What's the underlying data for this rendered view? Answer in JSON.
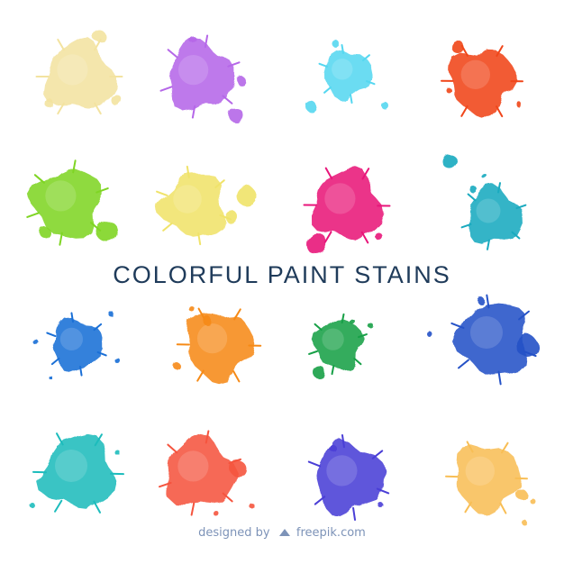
{
  "title": "COLORFUL PAINT STAINS",
  "credit": {
    "prefix": "designed by",
    "brand": "freepik.com"
  },
  "stains": [
    {
      "name": "cream",
      "color": "#f3e3a0"
    },
    {
      "name": "purple",
      "color": "#b567e8"
    },
    {
      "name": "cyan",
      "color": "#55d7f0"
    },
    {
      "name": "red-orange",
      "color": "#f0461a"
    },
    {
      "name": "lime-green",
      "color": "#7fd524"
    },
    {
      "name": "yellow",
      "color": "#f0e36a"
    },
    {
      "name": "magenta",
      "color": "#e8157a"
    },
    {
      "name": "teal",
      "color": "#1aaabf"
    },
    {
      "name": "blue",
      "color": "#1a6fd6"
    },
    {
      "name": "orange",
      "color": "#f68a16"
    },
    {
      "name": "green",
      "color": "#17a047"
    },
    {
      "name": "royal-blue",
      "color": "#2552c7"
    },
    {
      "name": "turquoise",
      "color": "#1cbcbc"
    },
    {
      "name": "coral",
      "color": "#f5543e"
    },
    {
      "name": "violet",
      "color": "#4a3ed6"
    },
    {
      "name": "light-orange",
      "color": "#f8be55"
    }
  ]
}
